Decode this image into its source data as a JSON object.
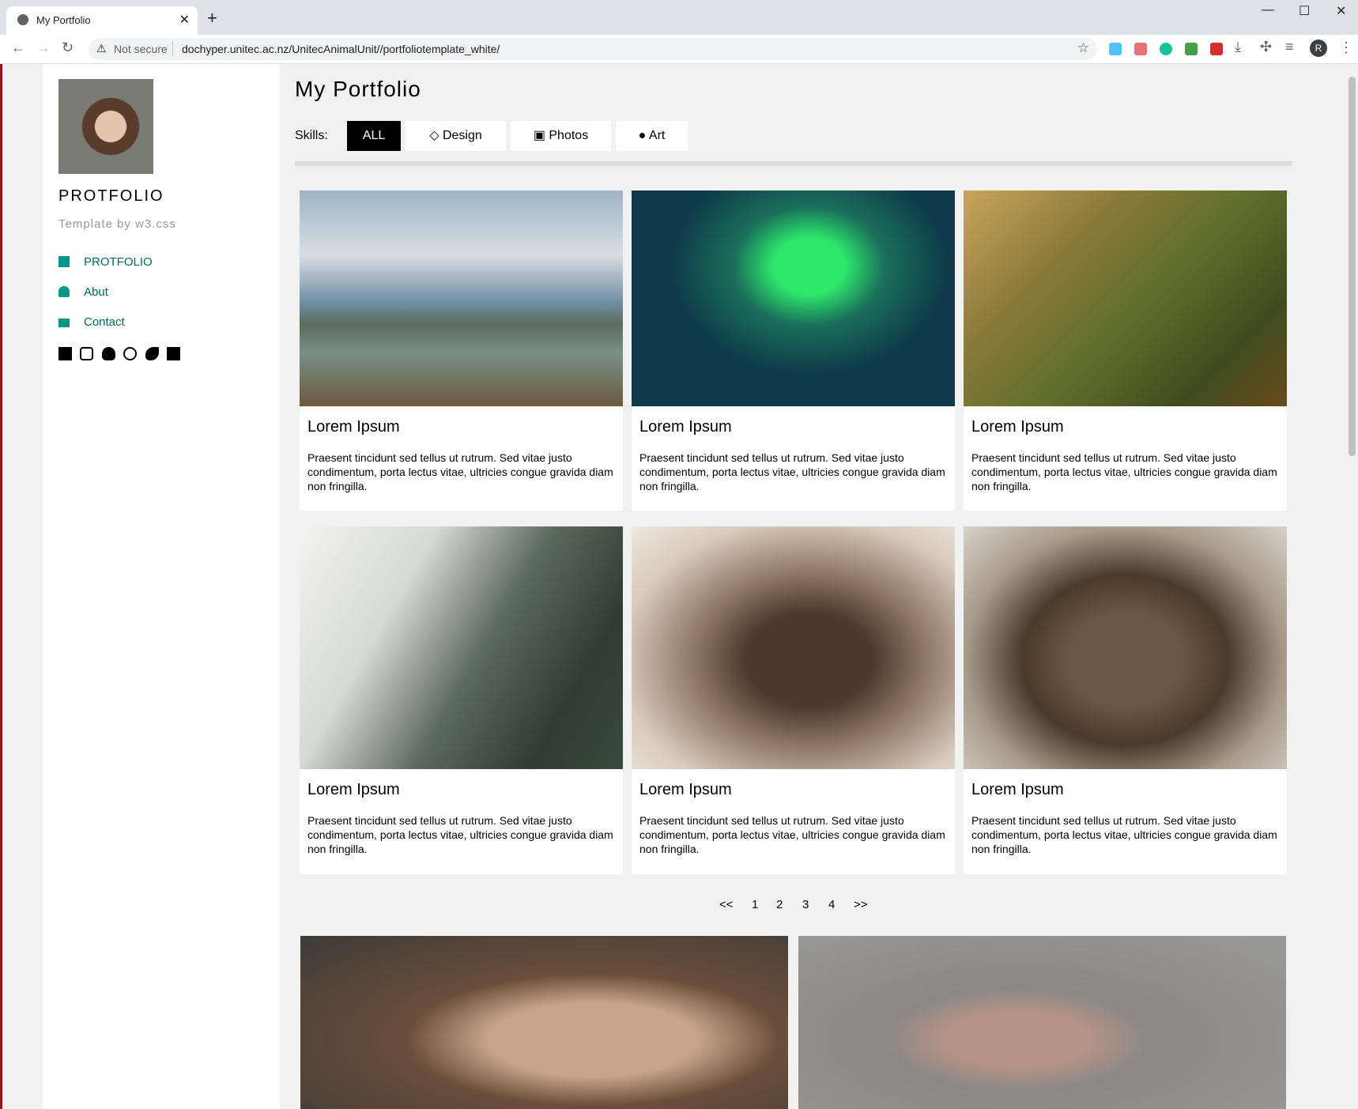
{
  "browser": {
    "tab_title": "My Portfolio",
    "not_secure": "Not secure",
    "url": "dochyper.unitec.ac.nz/UnitecAnimalUnit//portfoliotemplate_white/",
    "profile_initial": "R"
  },
  "sidebar": {
    "brand": "PROTFOLIO",
    "subtitle": "Template by w3.css",
    "nav": [
      {
        "label": "PROTFOLIO",
        "icon": "grid-icon"
      },
      {
        "label": "Abut",
        "icon": "user-icon"
      },
      {
        "label": "Contact",
        "icon": "envelope-icon"
      }
    ],
    "social_icons": [
      "facebook-icon",
      "instagram-icon",
      "snapchat-icon",
      "pinterest-icon",
      "twitter-icon",
      "linkedin-icon"
    ]
  },
  "main": {
    "title": "My Portfolio",
    "skills_label": "Skills:",
    "filters": [
      {
        "label": "ALL",
        "icon": ""
      },
      {
        "label": "Design",
        "icon": "diamond-icon"
      },
      {
        "label": "Photos",
        "icon": "photo-icon"
      },
      {
        "label": "Art",
        "icon": "map-pin-icon"
      }
    ],
    "cards": [
      {
        "title": "Lorem Ipsum",
        "text": "Praesent tincidunt sed tellus ut rutrum. Sed vitae justo condimentum, porta lectus vitae, ultricies congue gravida diam non fringilla.",
        "image": "mountain-lake"
      },
      {
        "title": "Lorem Ipsum",
        "text": "Praesent tincidunt sed tellus ut rutrum. Sed vitae justo condimentum, porta lectus vitae, ultricies congue gravida diam non fringilla.",
        "image": "northern-lights"
      },
      {
        "title": "Lorem Ipsum",
        "text": "Praesent tincidunt sed tellus ut rutrum. Sed vitae justo condimentum, porta lectus vitae, ultricies congue gravida diam non fringilla.",
        "image": "forest-valley"
      },
      {
        "title": "Lorem Ipsum",
        "text": "Praesent tincidunt sed tellus ut rutrum. Sed vitae justo condimentum, porta lectus vitae, ultricies congue gravida diam non fringilla.",
        "image": "misty-mountain"
      },
      {
        "title": "Lorem Ipsum",
        "text": "Praesent tincidunt sed tellus ut rutrum. Sed vitae justo condimentum, porta lectus vitae, ultricies congue gravida diam non fringilla.",
        "image": "coffee-beans"
      },
      {
        "title": "Lorem Ipsum",
        "text": "Praesent tincidunt sed tellus ut rutrum. Sed vitae justo condimentum, porta lectus vitae, ultricies congue gravida diam non fringilla.",
        "image": "brown-bear"
      }
    ],
    "pager": [
      "<<",
      "1",
      "2",
      "3",
      "4",
      ">>"
    ]
  },
  "colors": {
    "accent": "#009688",
    "nav_text": "#00695c",
    "active_filter": "#000000"
  }
}
